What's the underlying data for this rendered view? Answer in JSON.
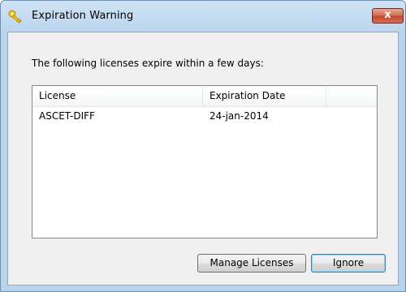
{
  "window": {
    "title": "Expiration Warning",
    "title_icon": "key-icon",
    "close_icon": "close-icon",
    "close_glyph": "x"
  },
  "dialog": {
    "message": "The following licenses expire within a few days:"
  },
  "licenses_table": {
    "columns": [
      "License",
      "Expiration Date"
    ],
    "rows": [
      [
        "ASCET-DIFF",
        "24-jan-2014"
      ]
    ]
  },
  "buttons": {
    "manage_label": "Manage Licenses",
    "ignore_label": "Ignore"
  },
  "colors": {
    "title_bar": "#b9d3ec",
    "close_button": "#c14a2c",
    "dialog_background": "#f0f0f0",
    "default_button_border": "#3c7fb1"
  }
}
